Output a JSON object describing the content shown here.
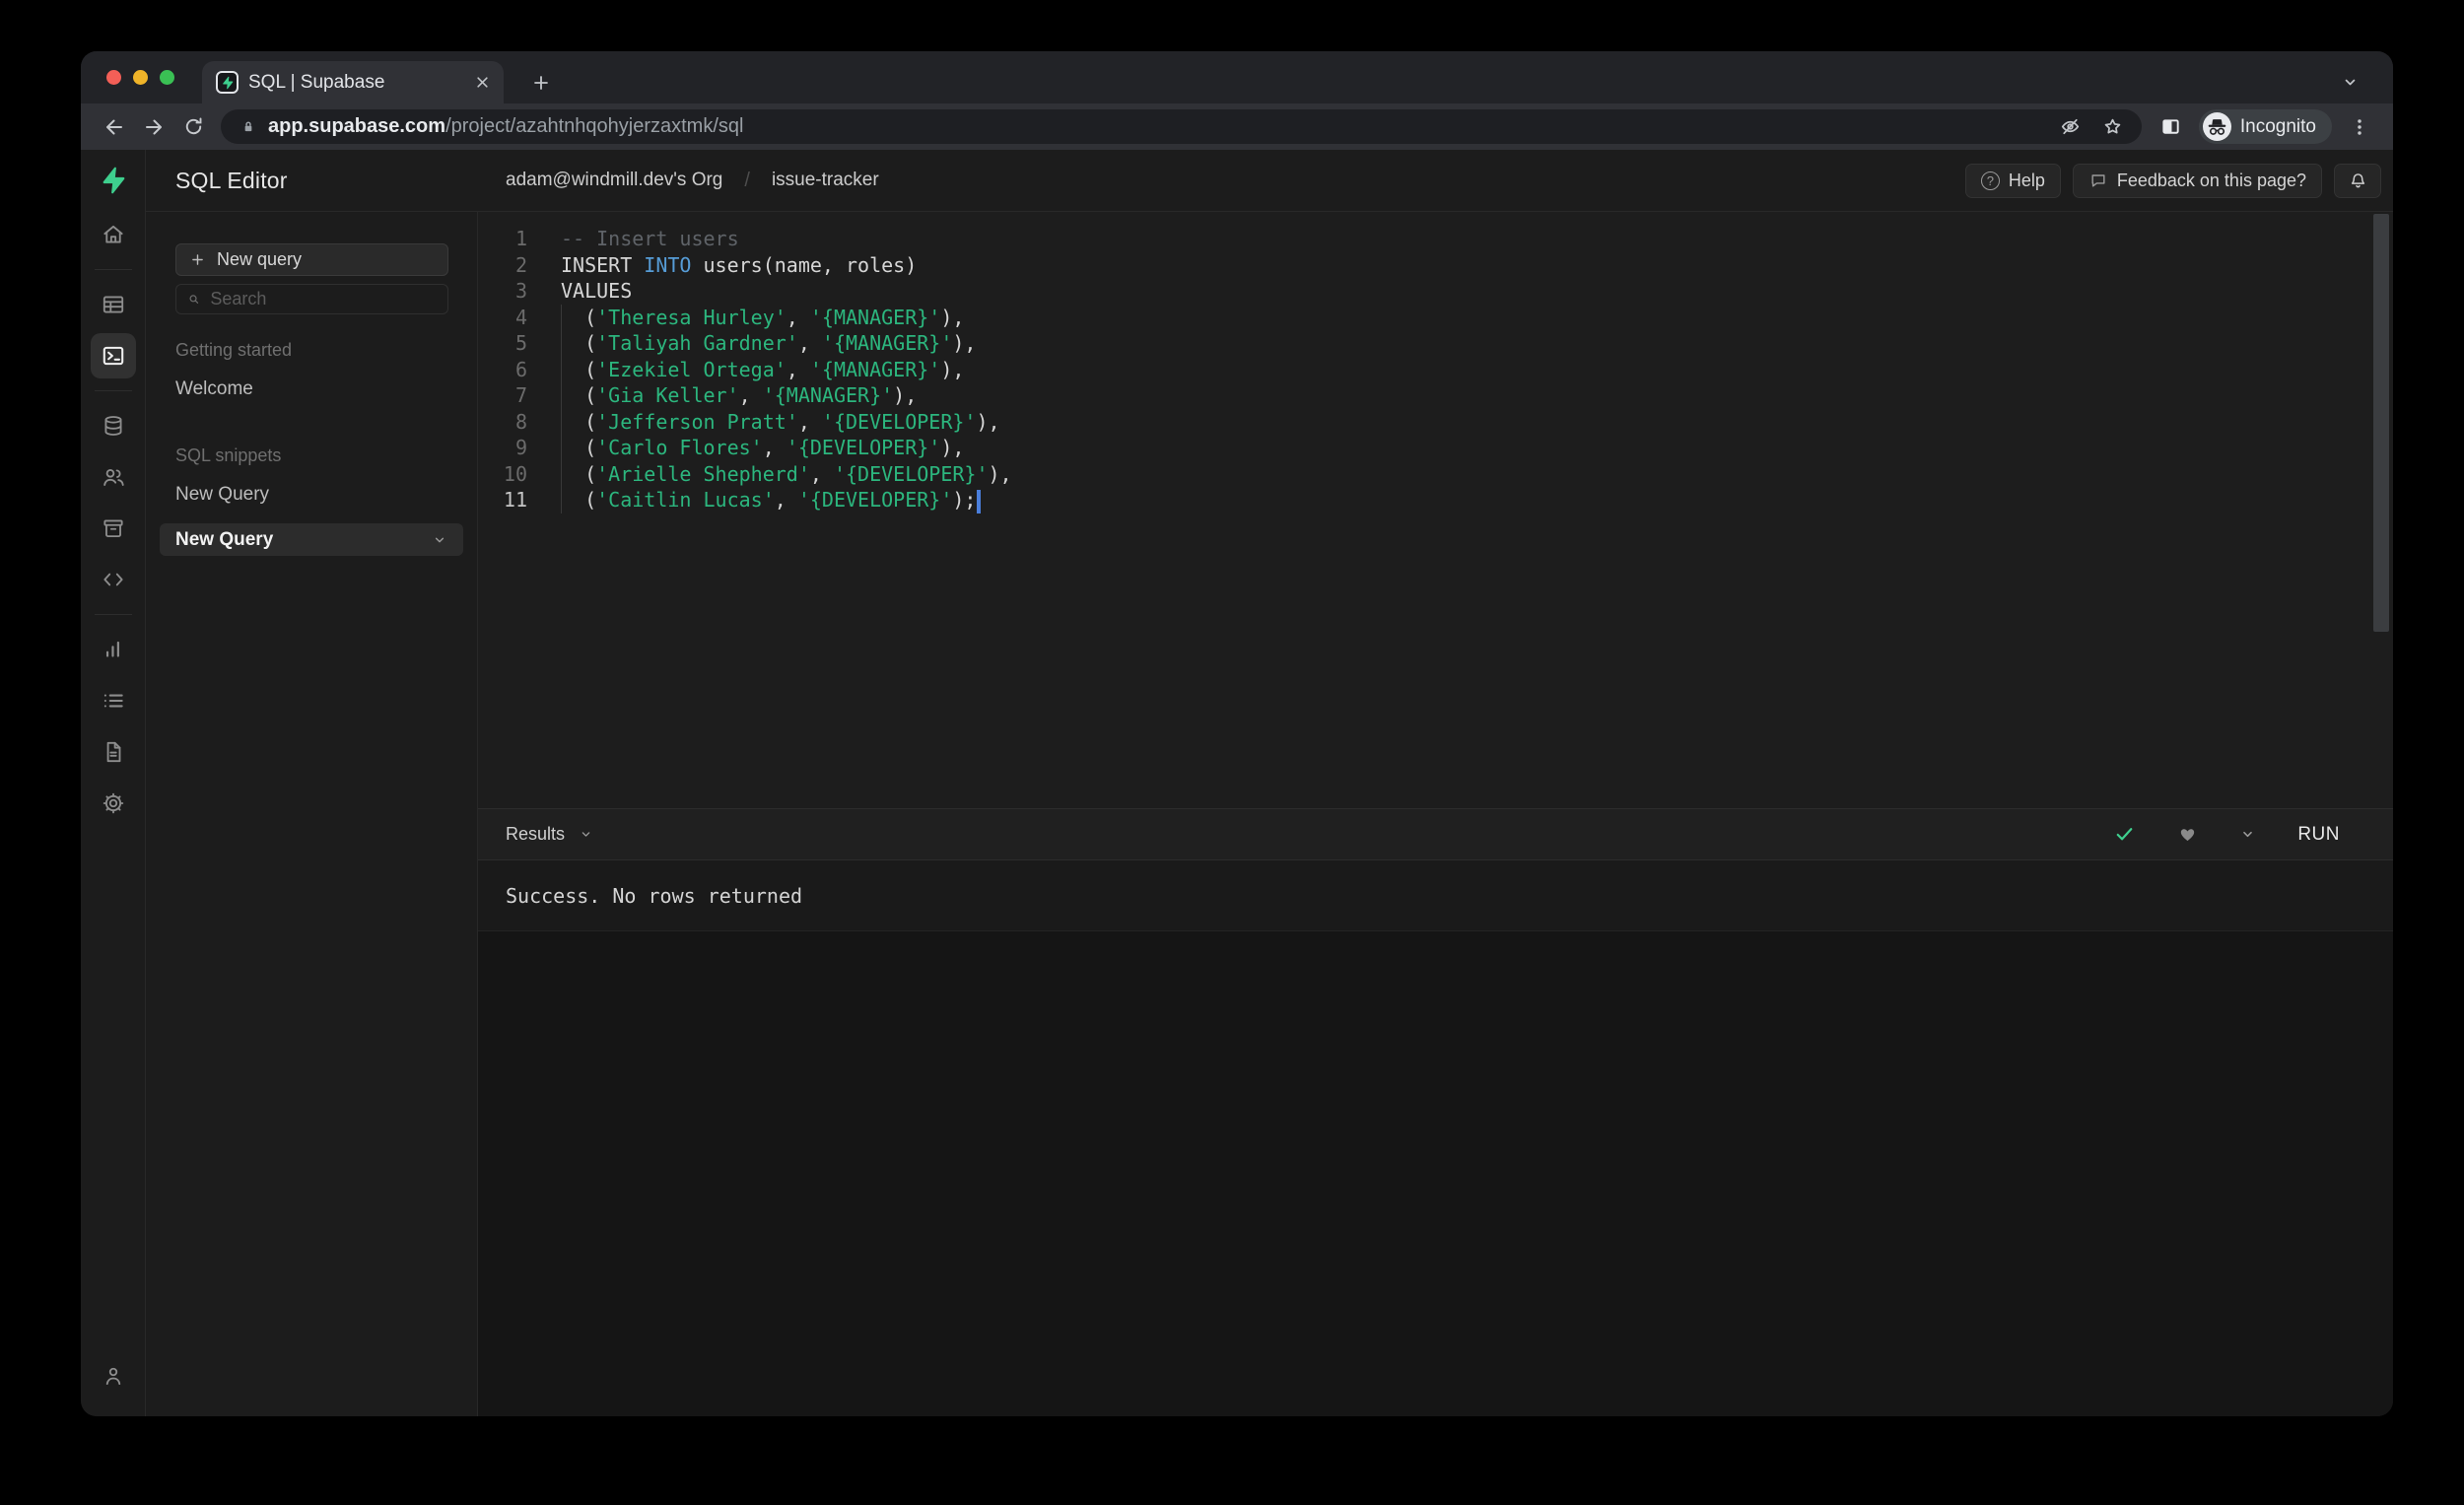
{
  "colors": {
    "accent": "#3ecf8e",
    "string": "#2cb67e",
    "keyword": "#569cd6"
  },
  "browser": {
    "tab_title": "SQL | Supabase",
    "url_host": "app.supabase.com",
    "url_path": "/project/azahtnhqohyjerzaxtmk/sql",
    "incognito_label": "Incognito"
  },
  "app": {
    "title": "SQL Editor",
    "breadcrumb": {
      "org": "adam@windmill.dev's Org",
      "project": "issue-tracker"
    },
    "help_label": "Help",
    "feedback_label": "Feedback on this page?"
  },
  "sidebar": {
    "new_query_button": "New query",
    "search_placeholder": "Search",
    "sections": [
      {
        "label": "Getting started",
        "items": [
          {
            "label": "Welcome",
            "active": false
          }
        ]
      },
      {
        "label": "SQL snippets",
        "items": [
          {
            "label": "New Query",
            "active": false
          },
          {
            "label": "New Query",
            "active": true
          }
        ]
      }
    ]
  },
  "editor": {
    "lines": [
      {
        "tokens": [
          {
            "t": "-- Insert users",
            "y": "comment"
          }
        ]
      },
      {
        "tokens": [
          {
            "t": "INSERT ",
            "y": "plain"
          },
          {
            "t": "INTO",
            "y": "keyword"
          },
          {
            "t": " users(name, roles)",
            "y": "plain"
          }
        ]
      },
      {
        "tokens": [
          {
            "t": "VALUES",
            "y": "plain"
          }
        ]
      },
      {
        "guide": true,
        "tokens": [
          {
            "t": "  (",
            "y": "plain"
          },
          {
            "t": "'Theresa Hurley'",
            "y": "string"
          },
          {
            "t": ", ",
            "y": "plain"
          },
          {
            "t": "'{MANAGER}'",
            "y": "string"
          },
          {
            "t": "),",
            "y": "plain"
          }
        ]
      },
      {
        "guide": true,
        "tokens": [
          {
            "t": "  (",
            "y": "plain"
          },
          {
            "t": "'Taliyah Gardner'",
            "y": "string"
          },
          {
            "t": ", ",
            "y": "plain"
          },
          {
            "t": "'{MANAGER}'",
            "y": "string"
          },
          {
            "t": "),",
            "y": "plain"
          }
        ]
      },
      {
        "guide": true,
        "tokens": [
          {
            "t": "  (",
            "y": "plain"
          },
          {
            "t": "'Ezekiel Ortega'",
            "y": "string"
          },
          {
            "t": ", ",
            "y": "plain"
          },
          {
            "t": "'{MANAGER}'",
            "y": "string"
          },
          {
            "t": "),",
            "y": "plain"
          }
        ]
      },
      {
        "guide": true,
        "tokens": [
          {
            "t": "  (",
            "y": "plain"
          },
          {
            "t": "'Gia Keller'",
            "y": "string"
          },
          {
            "t": ", ",
            "y": "plain"
          },
          {
            "t": "'{MANAGER}'",
            "y": "string"
          },
          {
            "t": "),",
            "y": "plain"
          }
        ]
      },
      {
        "guide": true,
        "tokens": [
          {
            "t": "  (",
            "y": "plain"
          },
          {
            "t": "'Jefferson Pratt'",
            "y": "string"
          },
          {
            "t": ", ",
            "y": "plain"
          },
          {
            "t": "'{DEVELOPER}'",
            "y": "string"
          },
          {
            "t": "),",
            "y": "plain"
          }
        ]
      },
      {
        "guide": true,
        "tokens": [
          {
            "t": "  (",
            "y": "plain"
          },
          {
            "t": "'Carlo Flores'",
            "y": "string"
          },
          {
            "t": ", ",
            "y": "plain"
          },
          {
            "t": "'{DEVELOPER}'",
            "y": "string"
          },
          {
            "t": "),",
            "y": "plain"
          }
        ]
      },
      {
        "guide": true,
        "tokens": [
          {
            "t": "  (",
            "y": "plain"
          },
          {
            "t": "'Arielle Shepherd'",
            "y": "string"
          },
          {
            "t": ", ",
            "y": "plain"
          },
          {
            "t": "'{DEVELOPER}'",
            "y": "string"
          },
          {
            "t": "),",
            "y": "plain"
          }
        ]
      },
      {
        "guide": true,
        "active": true,
        "cursor": true,
        "tokens": [
          {
            "t": "  (",
            "y": "plain"
          },
          {
            "t": "'Caitlin Lucas'",
            "y": "string"
          },
          {
            "t": ", ",
            "y": "plain"
          },
          {
            "t": "'{DEVELOPER}'",
            "y": "string"
          },
          {
            "t": ");",
            "y": "plain"
          }
        ]
      }
    ]
  },
  "results": {
    "label": "Results",
    "run_label": "RUN",
    "message": "Success. No rows returned"
  }
}
